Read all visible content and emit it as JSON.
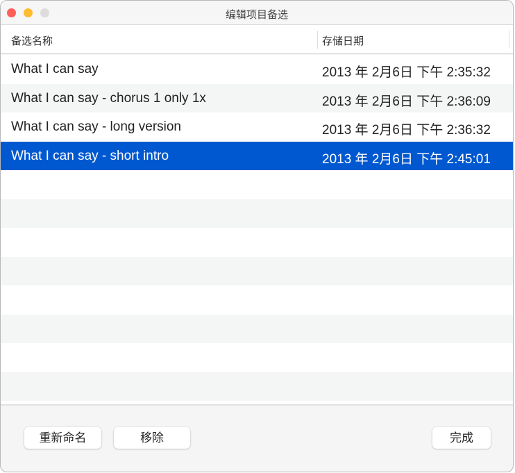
{
  "window": {
    "title": "编辑项目备选"
  },
  "table": {
    "columns": [
      "备选名称",
      "存储日期"
    ],
    "rows": [
      {
        "name": "What I can say",
        "date": "2013 年 2月6日  下午 2:35:32"
      },
      {
        "name": "What I can say - chorus 1 only 1x",
        "date": "2013 年 2月6日  下午 2:36:09"
      },
      {
        "name": "What I can say - long version",
        "date": "2013 年 2月6日  下午 2:36:32"
      },
      {
        "name": "What I can say - short intro",
        "date": "2013 年 2月6日  下午 2:45:01",
        "selected": true
      }
    ]
  },
  "buttons": {
    "rename": "重新命名",
    "remove": "移除",
    "done": "完成"
  },
  "colors": {
    "selection": "#0058d0",
    "close": "#fe5f57",
    "minimize": "#febc2e",
    "zoom": "#dcdcdc"
  }
}
